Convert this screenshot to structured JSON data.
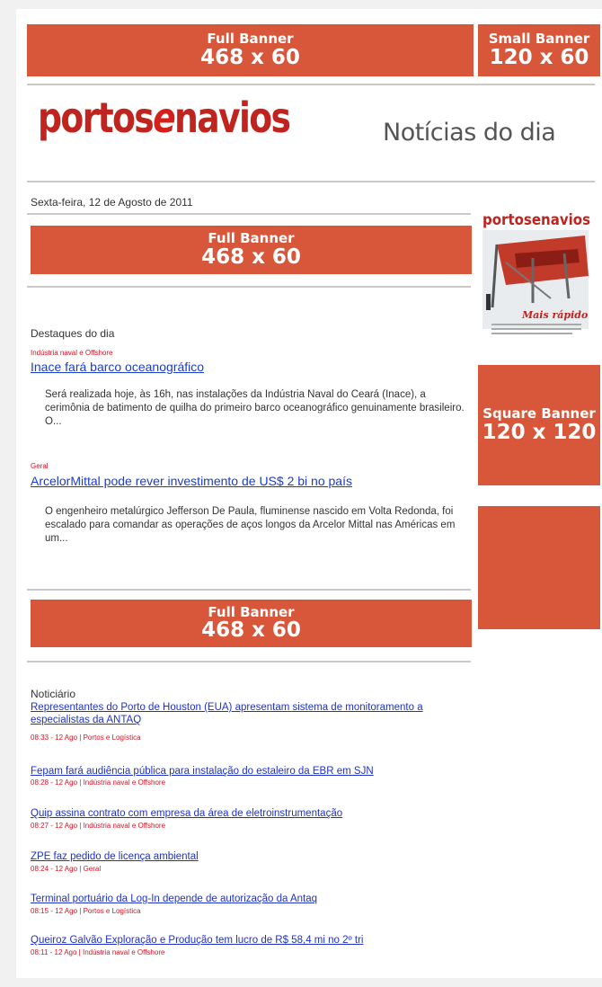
{
  "colors": {
    "banner": "#d8573b",
    "logo_red": "#c0241e",
    "link_blue": "#1a3ccf",
    "meta_red": "#dd1122"
  },
  "top_banner": {
    "line1": "Full Banner",
    "line2": "468 x 60"
  },
  "small_banner": {
    "line1": "Small Banner",
    "line2": "120 x 60"
  },
  "header": {
    "logo_part1": "portos",
    "logo_e": "e",
    "logo_part2": "navios",
    "tagline": "Notícias do dia"
  },
  "date": "Sexta-feira,  12 de Agosto de 2011",
  "mid_banner": {
    "line1": "Full Banner",
    "line2": "468 x 60"
  },
  "magazine": {
    "title": "portosenavios",
    "cover_text": "Mais rápido"
  },
  "square_banner": {
    "line1": "Square Banner",
    "line2": "120 x 120"
  },
  "highlights": {
    "title": "Destaques do dia",
    "items": [
      {
        "category": "Indústria naval e Offshore",
        "headline": "Inace fará barco oceanográfico",
        "summary": "Será realizada hoje, às 16h, nas instalações da Indústria Naval do Ceará (Inace), a cerimônia de batimento de quilha do primeiro barco oceanográfico genuinamente brasileiro. O..."
      },
      {
        "category": "Geral",
        "headline": "ArcelorMittal pode rever investimento de US$ 2 bi no país",
        "summary": "O engenheiro metalúrgico Jefferson De Paula, fluminense nascido em Volta Redonda, foi escalado para comandar as operações de aços longos da Arcelor Mittal nas Américas em um..."
      }
    ]
  },
  "bottom_banner": {
    "line1": "Full Banner",
    "line2": "468 x 60"
  },
  "news": {
    "title": "Noticiário",
    "items": [
      {
        "title": "Representantes do Porto de Houston (EUA) apresentam sistema de monitoramento a especialistas da ANTAQ",
        "meta": "08:33 - 12 Ago | Portos e Logística"
      },
      {
        "title": "Fepam fará audiência pública para instalação do estaleiro da EBR em SJN",
        "meta": "08:28 - 12 Ago | Indústria naval e Offshore"
      },
      {
        "title": "Quip assina contrato com empresa da área de eletroinstrumentação",
        "meta": "08:27 - 12 Ago | Indústria naval e Offshore"
      },
      {
        "title": "ZPE faz pedido de licença ambiental",
        "meta": "08:24 - 12 Ago | Geral"
      },
      {
        "title": "Terminal portuário da Log-In depende de autorização da Antaq",
        "meta": "08:15 - 12 Ago | Portos e Logística"
      },
      {
        "title": "Queiroz Galvão Exploração e Produção tem lucro de R$ 58,4 mi no 2º tri",
        "meta": "08:11 - 12 Ago | Indústria naval e Offshore"
      }
    ]
  }
}
